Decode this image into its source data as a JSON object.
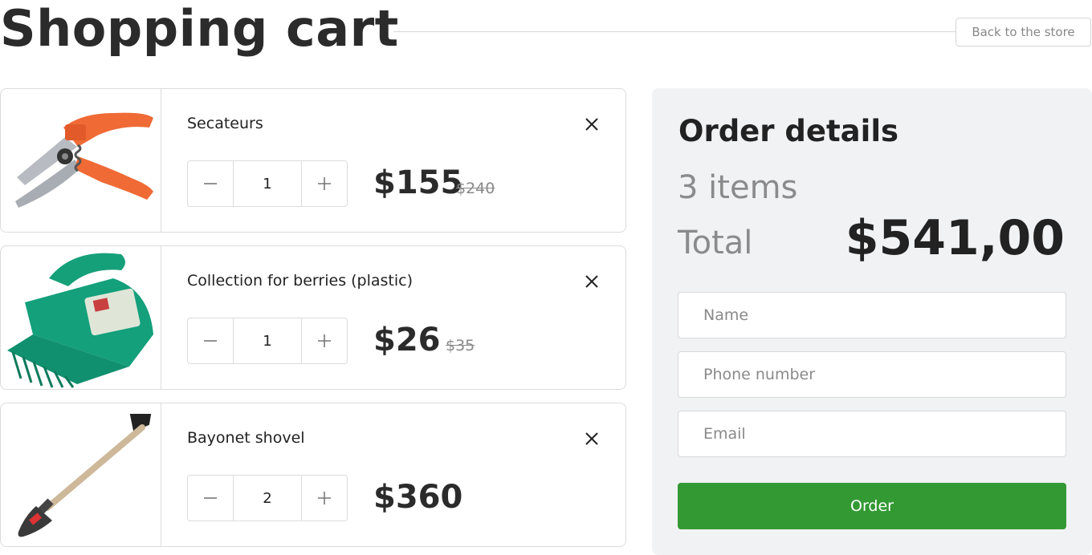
{
  "header": {
    "title": "Shopping cart",
    "back_label": "Back to the store"
  },
  "cart": {
    "items": [
      {
        "name": "Secateurs",
        "quantity": "1",
        "price": "$155",
        "old_price": "$240",
        "image_icon": "secateurs-icon"
      },
      {
        "name": "Collection for berries (plastic)",
        "quantity": "1",
        "price": "$26",
        "old_price": "$35",
        "image_icon": "berry-picker-icon"
      },
      {
        "name": "Bayonet shovel",
        "quantity": "2",
        "price": "$360",
        "old_price": "",
        "image_icon": "shovel-icon"
      }
    ]
  },
  "order": {
    "title": "Order details",
    "items_count": "3 items",
    "total_label": "Total",
    "total_value": "$541,00",
    "name_placeholder": "Name",
    "phone_placeholder": "Phone number",
    "email_placeholder": "Email",
    "submit_label": "Order"
  },
  "colors": {
    "accent_green": "#339933",
    "panel_bg": "#f1f2f4",
    "border": "#dcdcdc"
  }
}
